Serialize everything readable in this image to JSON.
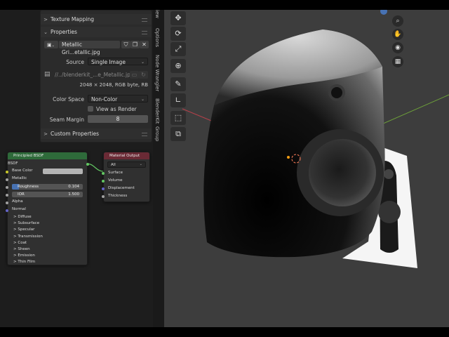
{
  "properties_panel": {
    "texture_mapping_label": "Texture Mapping",
    "properties_label": "Properties",
    "image_name": "Metallic Gri...etallic.jpg",
    "source_label": "Source",
    "source_value": "Single Image",
    "file_path": "//../blenderkit_...e_Metallic.jpg",
    "image_info": "2048 × 2048,  RGB byte, RB",
    "color_space_label": "Color Space",
    "color_space_value": "Non-Color",
    "view_as_render_label": "View as Render",
    "seam_margin_label": "Seam Margin",
    "seam_margin_value": "8",
    "custom_properties_label": "Custom Properties"
  },
  "side_tabs": [
    "iew",
    "Options",
    "Node Wrangler",
    "BlenderKit",
    "Group"
  ],
  "principled_node": {
    "title": "Principled BSDF",
    "output": "BSDF",
    "base_color_label": "Base Color",
    "metallic_label": "Metallic",
    "roughness_label": "Roughness",
    "roughness_value": "0.104",
    "ior_label": "IOR",
    "ior_value": "1.500",
    "alpha_label": "Alpha",
    "normal_label": "Normal",
    "sections": [
      "Diffuse",
      "Subsurface",
      "Specular",
      "Transmission",
      "Coat",
      "Sheen",
      "Emission",
      "Thin Film"
    ]
  },
  "output_node": {
    "title": "Material Output",
    "target": "All",
    "inputs": [
      "Surface",
      "Volume",
      "Displacement",
      "Thickness"
    ]
  },
  "viewport_tools": [
    "move-icon",
    "rotate-icon",
    "scale-icon",
    "transform-icon",
    "annotate-icon",
    "measure-icon",
    "add-cube-icon",
    "extrude-icon"
  ],
  "nav_gizmo": [
    "zoom-icon",
    "hand-icon",
    "camera-icon",
    "grid-icon"
  ],
  "colors": {
    "node_header_green": "#2e6a3a",
    "node_header_red": "#6a2a35",
    "socket_yellow": "#c7c729",
    "socket_gray": "#a1a1a1",
    "socket_purple": "#6363c7",
    "socket_green": "#63c763",
    "accent_blue": "#4772b3"
  }
}
